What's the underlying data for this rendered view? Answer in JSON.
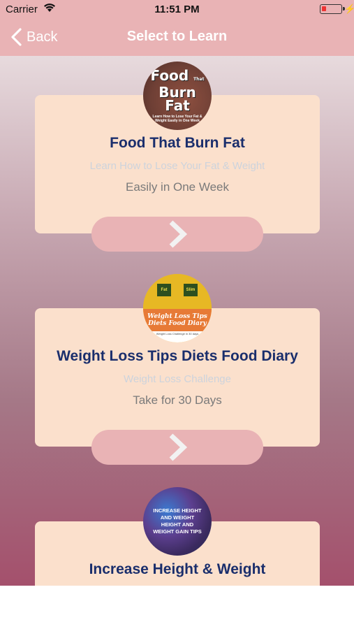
{
  "status_bar": {
    "carrier": "Carrier",
    "time": "11:51 PM"
  },
  "nav": {
    "back_label": "Back",
    "title": "Select to Learn"
  },
  "cards": [
    {
      "title": "Food That Burn Fat",
      "subtitle": "Learn How to Lose Your Fat & Weight",
      "description": "Easily in One Week",
      "badge": {
        "line1": "Food",
        "line2": "That",
        "line3": "Burn",
        "line4": "Fat",
        "caption": "Learn How to Lose Your Fat & Weight Easily in One Week"
      }
    },
    {
      "title": "Weight Loss Tips Diets Food Diary",
      "subtitle": "Weight Loss Challenge",
      "description": "Take for 30 Days",
      "badge": {
        "box_left": "Fat",
        "box_right": "Slim",
        "line1": "Weight Loss Tips",
        "line2": "Diets Food Diary",
        "caption": "Weight Loss Challenge in 30 days"
      }
    },
    {
      "title": "Increase Height & Weight",
      "badge": {
        "text": "INCREASE HEIGHT AND WEIGHT HEIGHT AND WEIGHT GAIN TIPS"
      }
    }
  ],
  "icons": {
    "back": "chevron-left-icon",
    "next": "chevron-right-icon",
    "wifi": "wifi-icon",
    "battery": "battery-icon"
  },
  "colors": {
    "nav_bar": "#e9b3b5",
    "card": "#fbe0cc",
    "title": "#1a2e6c",
    "button": "#e9b3b5"
  }
}
